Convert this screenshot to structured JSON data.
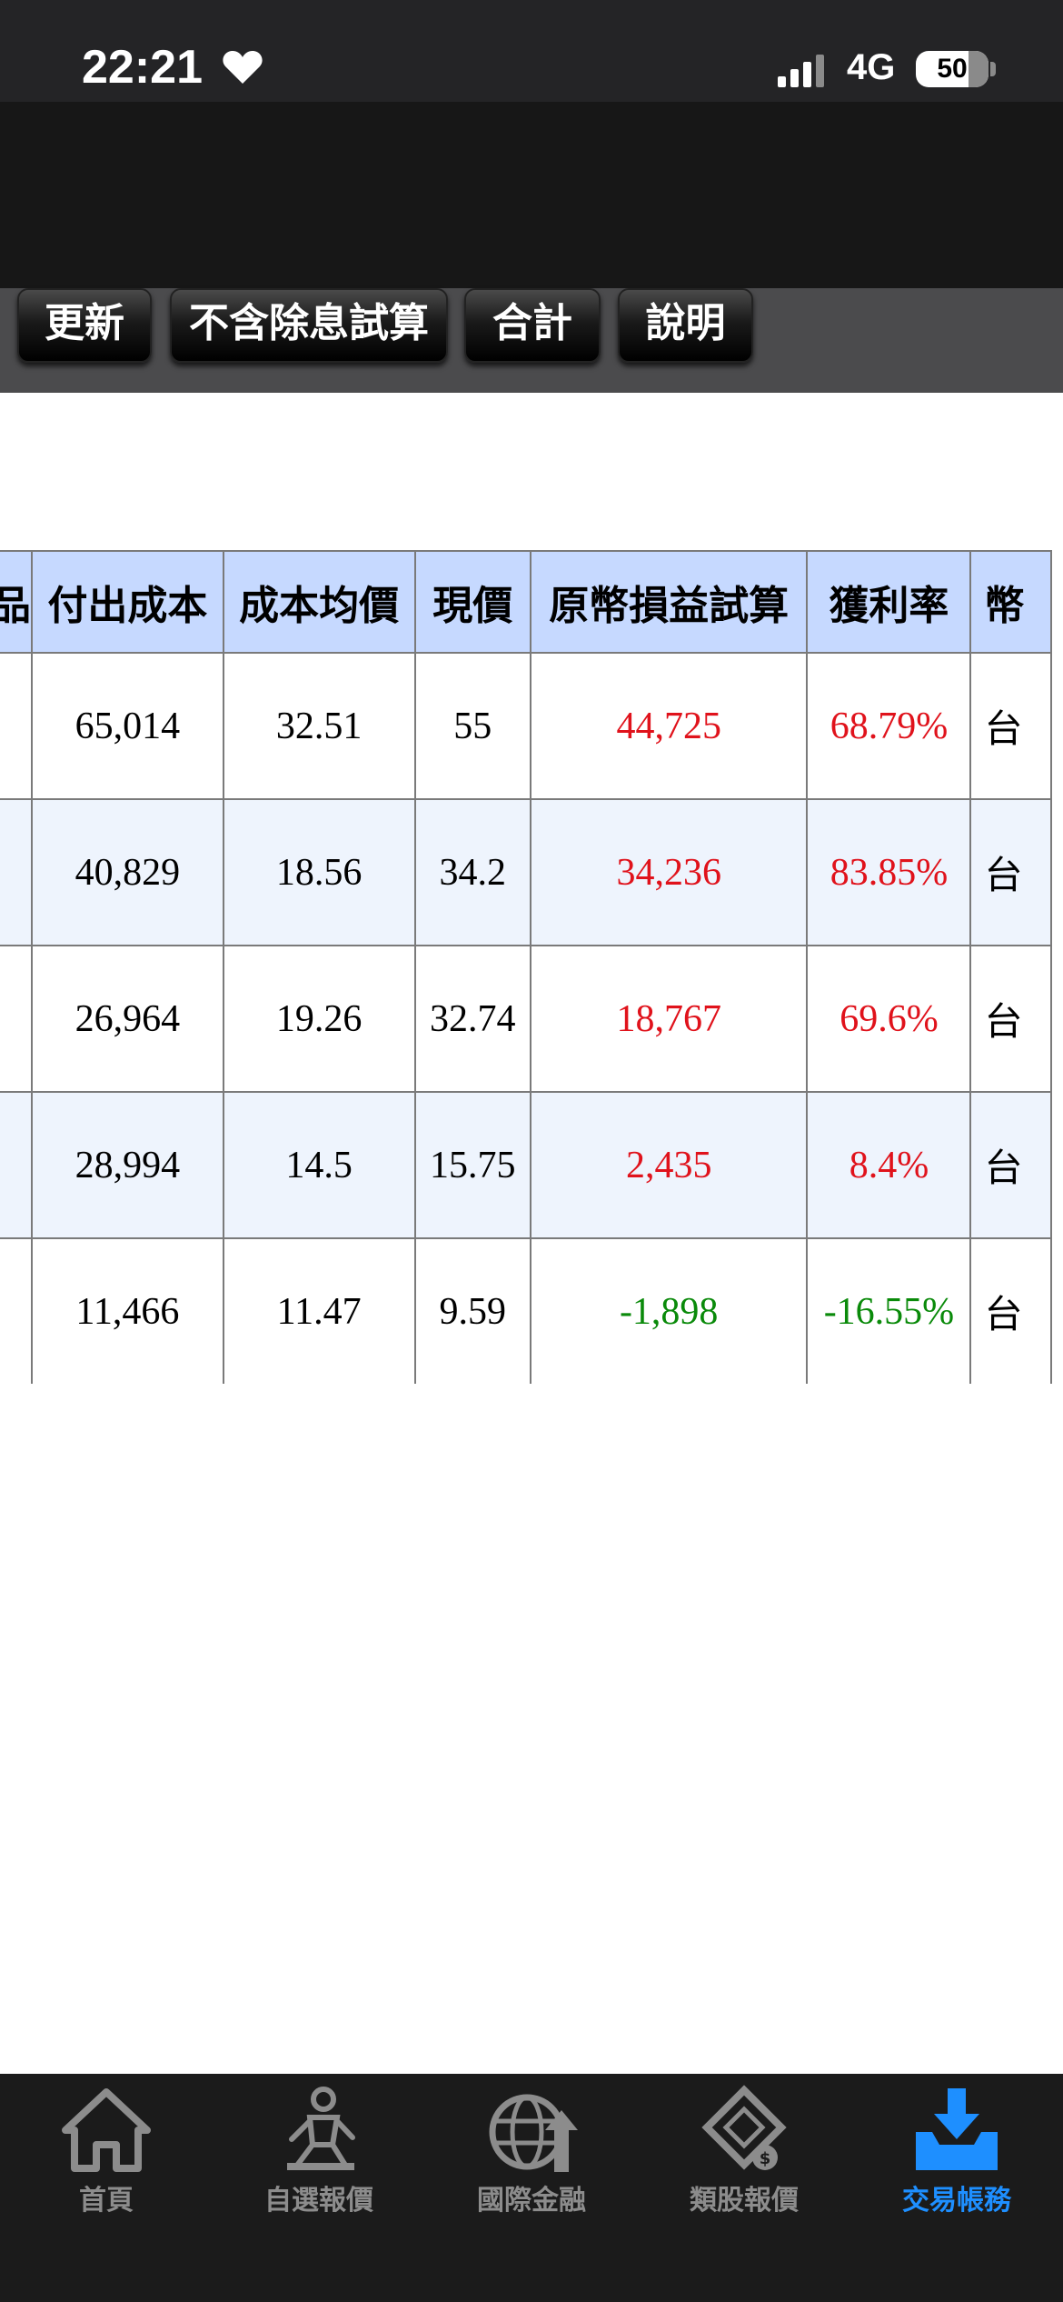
{
  "status_bar": {
    "time": "22:21",
    "network": "4G",
    "battery": "50",
    "icons": [
      "heart-icon",
      "signal-icon",
      "battery-icon"
    ]
  },
  "toolbar": {
    "buttons": [
      "更新",
      "不含除息試算",
      "合計",
      "說明"
    ]
  },
  "table": {
    "headers": [
      "品",
      "付出成本",
      "成本均價",
      "現價",
      "原幣損益試算",
      "獲利率",
      "幣"
    ],
    "rows": [
      {
        "cost": "65,014",
        "avg": "32.51",
        "price": "55",
        "pnl": "44,725",
        "rate": "68.79%",
        "cur": "台"
      },
      {
        "cost": "40,829",
        "avg": "18.56",
        "price": "34.2",
        "pnl": "34,236",
        "rate": "83.85%",
        "cur": "台"
      },
      {
        "cost": "26,964",
        "avg": "19.26",
        "price": "32.74",
        "pnl": "18,767",
        "rate": "69.6%",
        "cur": "台"
      },
      {
        "cost": "28,994",
        "avg": "14.5",
        "price": "15.75",
        "pnl": "2,435",
        "rate": "8.4%",
        "cur": "台"
      },
      {
        "cost": "11,466",
        "avg": "11.47",
        "price": "9.59",
        "pnl": "-1,898",
        "rate": "-16.55%",
        "cur": "台"
      }
    ],
    "colors": {
      "gain": "#e0121b",
      "loss": "#0a8a0a",
      "header_bg": "#c6d9ff",
      "alt_row_bg": "#eef4fd"
    }
  },
  "bottom_nav": {
    "items": [
      {
        "label": "首頁",
        "icon": "home-icon"
      },
      {
        "label": "自選報價",
        "icon": "person-trading-icon"
      },
      {
        "label": "國際金融",
        "icon": "globe-icon"
      },
      {
        "label": "類股報價",
        "icon": "film-dollar-icon"
      },
      {
        "label": "交易帳務",
        "icon": "download-tray-icon"
      }
    ],
    "active_index": 4,
    "active_color": "#1e8fff"
  }
}
